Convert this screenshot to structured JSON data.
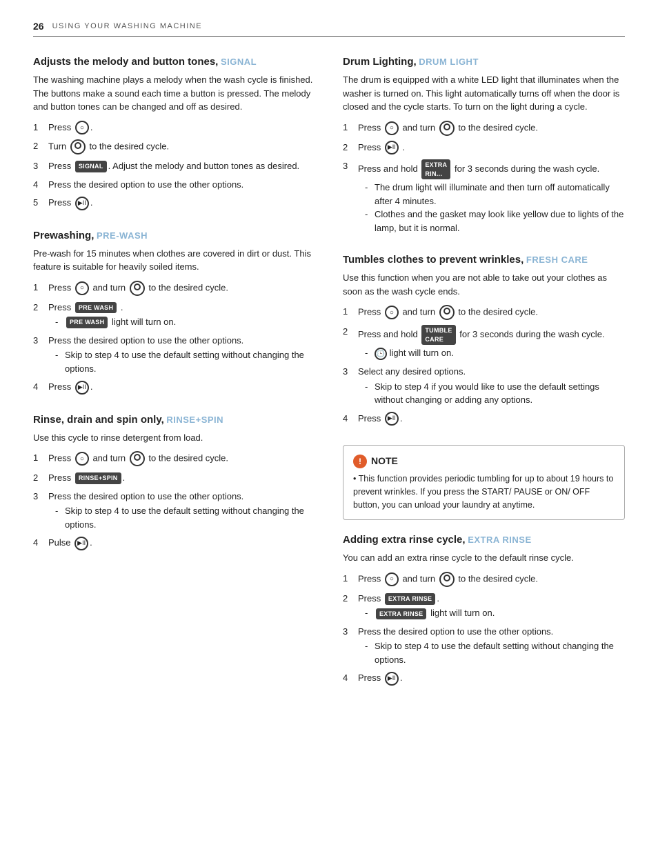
{
  "header": {
    "page_number": "26",
    "title": "USING YOUR WASHING MACHINE"
  },
  "left_column": {
    "section1": {
      "title": "Adjusts the melody and button tones,",
      "subtitle": "SIGNAL",
      "description": "The washing machine plays a melody when the wash cycle is finished. The buttons make a sound each time a button is pressed. The melody and button tones can be changed and off as desired.",
      "steps": [
        {
          "num": "1",
          "text": "Press",
          "has_circle_o": true,
          "after": "."
        },
        {
          "num": "2",
          "text": "Turn",
          "has_knob": true,
          "after": " to the desired cycle."
        },
        {
          "num": "3",
          "text": "Press",
          "has_btn": true,
          "btn_text": "SIGNAL",
          "after": ". Adjust the melody and button tones as desired."
        },
        {
          "num": "4",
          "text": "Press the desired option to use the other options."
        },
        {
          "num": "5",
          "text": "Press",
          "has_play": true,
          "after": "."
        }
      ]
    },
    "section2": {
      "title": "Prewashing,",
      "subtitle": "PRE-WASH",
      "description": "Pre-wash for 15 minutes when clothes are covered in dirt or dust. This feature is suitable for heavily soiled items.",
      "steps": [
        {
          "num": "1",
          "text": "Press",
          "has_circle_o": true,
          "after": " and turn",
          "has_knob": true,
          "after2": " to the desired cycle."
        },
        {
          "num": "2",
          "text": "Press",
          "has_btn": true,
          "btn_text": "PRE WASH",
          "after": ".",
          "sub": [
            "PRE WASH light will turn on."
          ]
        },
        {
          "num": "3",
          "text": "Press the desired option to use the other options.",
          "sub": [
            "Skip to step 4 to use the default setting without changing the options."
          ]
        },
        {
          "num": "4",
          "text": "Press",
          "has_play": true,
          "after": "."
        }
      ]
    },
    "section3": {
      "title": "Rinse, drain and spin only,",
      "subtitle": "RINSE+SPIN",
      "description": "Use this cycle to rinse detergent from load.",
      "steps": [
        {
          "num": "1",
          "text": "Press",
          "has_circle_o": true,
          "after": " and turn",
          "has_knob": true,
          "after2": " to the desired cycle."
        },
        {
          "num": "2",
          "text": "Press",
          "has_btn": true,
          "btn_text": "RINSE+SPIN",
          "after": "."
        },
        {
          "num": "3",
          "text": "Press the desired option to use the other options.",
          "sub": [
            "Skip to step 4 to use the default setting without changing the options."
          ]
        },
        {
          "num": "4",
          "text": "Pulse",
          "has_play": true,
          "after": "."
        }
      ]
    }
  },
  "right_column": {
    "section1": {
      "title": "Drum Lighting,",
      "subtitle": "DRUM LIGHT",
      "description": "The drum is equipped with a white LED light that illuminates when the washer is turned on. This light automatically turns off when the door is closed and the cycle starts. To turn on the light during a cycle.",
      "steps": [
        {
          "num": "1",
          "text": "Press",
          "has_circle_o": true,
          "after": " and turn",
          "has_knob": true,
          "after2": " to the desired cycle."
        },
        {
          "num": "2",
          "text": "Press",
          "has_play": true,
          "after": " ."
        },
        {
          "num": "3",
          "text": "Press and hold",
          "has_btn": true,
          "btn_text": "EXTRA RIN...",
          "after": " for 3 seconds during the wash cycle.",
          "sub": [
            "The drum light will illuminate and then turn off automatically after 4 minutes.",
            "Clothes and the gasket may look like yellow due to lights of the lamp, but it is normal."
          ]
        }
      ]
    },
    "section2": {
      "title": "Tumbles clothes to prevent wrinkles,",
      "subtitle": "FRESH CARE",
      "description": "Use this function when you are not able to take out your clothes as soon as the wash cycle ends.",
      "steps": [
        {
          "num": "1",
          "text": "Press",
          "has_circle_o": true,
          "after": " and turn",
          "has_knob": true,
          "after2": " to the desired cycle."
        },
        {
          "num": "2",
          "text": "Press and hold",
          "has_btn": true,
          "btn_text": "TUMBLE CARE",
          "after": " for 3 seconds during the wash cycle.",
          "sub": [
            "light will turn on."
          ]
        },
        {
          "num": "3",
          "text": "Select any desired options.",
          "sub": [
            "Skip  to step 4 if you would like to use the default settings without changing or adding any options."
          ]
        },
        {
          "num": "4",
          "text": "Press",
          "has_play": true,
          "after": "."
        }
      ]
    },
    "note": {
      "title": "NOTE",
      "icon": "!",
      "text": "This function provides periodic tumbling for up to about 19 hours to prevent wrinkles. If you press the START/ PAUSE or ON/ OFF button, you can unload your laundry at anytime."
    },
    "section3": {
      "title": "Adding extra rinse cycle,",
      "subtitle": "EXTRA RINSE",
      "description": "You can add an extra rinse cycle to the default rinse cycle.",
      "steps": [
        {
          "num": "1",
          "text": "Press",
          "has_circle_o": true,
          "after": " and turn",
          "has_knob": true,
          "after2": " to the desired cycle."
        },
        {
          "num": "2",
          "text": "Press",
          "has_btn": true,
          "btn_text": "EXTRA RINSE",
          "after": ".",
          "sub": [
            "light will turn on."
          ]
        },
        {
          "num": "3",
          "text": "Press the desired option to use the other options.",
          "sub": [
            "Skip to step 4 to use the default setting without changing the options."
          ]
        },
        {
          "num": "4",
          "text": "Press",
          "has_play": true,
          "after": "."
        }
      ]
    }
  }
}
